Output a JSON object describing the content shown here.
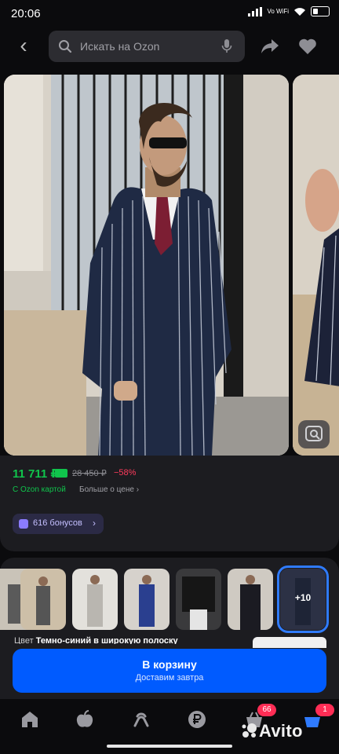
{
  "status": {
    "time": "20:06",
    "network": "Vo WiFi"
  },
  "search": {
    "placeholder": "Искать на Ozon"
  },
  "product": {
    "price": "11 711 ₽",
    "old_price": "28 450 ₽",
    "discount": "−58%",
    "card_label": "С Ozon картой",
    "more_price": "Больше о цене",
    "bonus": "616 бонусов"
  },
  "variants": {
    "more_count": "+10",
    "color_label": "Цвет",
    "color_value": "Темно-синий в широкую полоску"
  },
  "cart": {
    "title": "В корзину",
    "subtitle": "Доставим завтра"
  },
  "nav": {
    "cart_badge": "66",
    "profile_badge": "1"
  },
  "watermark": "Avito",
  "colors": {
    "accent": "#005bff",
    "price": "#10c44c",
    "discount": "#ff3b5c",
    "badge": "#ff2d55"
  }
}
